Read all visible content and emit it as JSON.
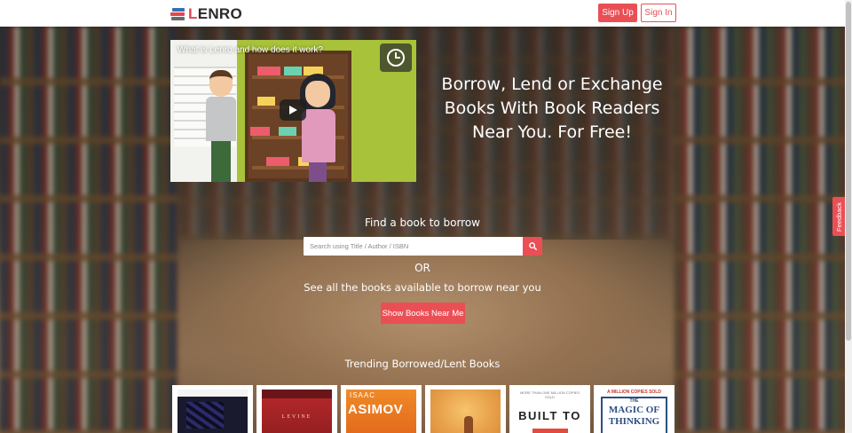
{
  "header": {
    "logo_prefix": "L",
    "logo_rest": "ENRO",
    "signup_label": "Sign Up",
    "signin_label": "Sign In"
  },
  "video": {
    "title": "What is Lenro and how does it work?"
  },
  "hero": {
    "tagline": "Borrow, Lend or Exchange Books With Book Readers Near You. For Free!",
    "find_label": "Find a book to borrow",
    "search_placeholder": "Search using Title / Author / ISBN",
    "or_text": "OR",
    "near_text": "See all the books available to borrow near you",
    "near_button_label": "Show Books Near Me"
  },
  "trending": {
    "title": "Trending Borrowed/Lent Books",
    "books": [
      {
        "cover_text": ""
      },
      {
        "cover_text": "LEVINE"
      },
      {
        "cover_top": "ISAAC",
        "cover_text": "ASIMOV"
      },
      {
        "cover_text": ""
      },
      {
        "cover_small": "MORE THAN ONE MILLION COPIES SOLD",
        "cover_text": "BUILT TO"
      },
      {
        "cover_small": "A MILLION COPIES SOLD",
        "cover_top": "THE",
        "cover_text": "MAGIC OF THINKING"
      }
    ]
  },
  "feedback": {
    "label": "Feedback"
  },
  "colors": {
    "accent": "#ea4f55",
    "logo_blue": "#3a6fb5"
  },
  "icons": {
    "logo": "books-stack-icon",
    "search": "search-icon",
    "play": "play-icon",
    "watch_later": "clock-icon"
  }
}
